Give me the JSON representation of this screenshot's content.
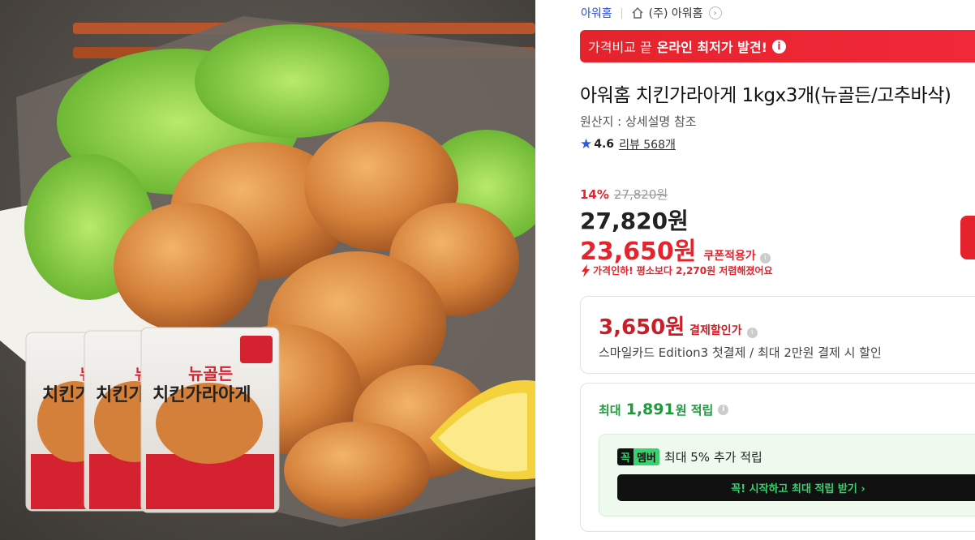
{
  "breadcrumb": {
    "brand": "아워홈",
    "shop": "(주) 아워홈"
  },
  "banner": {
    "prefix": "가격비교 끝",
    "message": "온라인 최저가 발견!",
    "info_icon": "info-icon"
  },
  "product": {
    "title": "아워홈 치킨가라아게 1kgx3개(뉴골든/고추바삭)",
    "origin": "원산지 : 상세설명 참조",
    "rating": "4.6",
    "review_link": "리뷰 568개"
  },
  "image": {
    "package_line1": "뉴골든",
    "package_line2": "치킨가라아게",
    "package_partial1": "뉴",
    "package_partial2": "치킨가",
    "package_partial3": "치킨가"
  },
  "pricing": {
    "discount_rate": "14%",
    "original_price": "27,820원",
    "price": "27,820원",
    "coupon_price": "23,650원",
    "coupon_label": "쿠폰적용가",
    "price_drop_note": "가격인하! 평소보다 2,270원 저렴해졌어요"
  },
  "payment": {
    "amount": "3,650원",
    "label": "결제할인가",
    "description": "스마일카드 Edition3 첫결제 / 최대 2만원 결제 시 할인"
  },
  "points": {
    "prefix": "최대",
    "amount": "1,891",
    "suffix": "원 적립",
    "member_badge_a": "꼭",
    "member_badge_b": "멤버",
    "member_text": "최대 5% 추가 적립",
    "member_cta": "꼭! 시작하고 최대 적립 받기 ›"
  },
  "colors": {
    "accent_red": "#e5232c",
    "brand_blue": "#2d4fcf",
    "point_green": "#1e9a3c",
    "member_green": "#3bd16f"
  }
}
